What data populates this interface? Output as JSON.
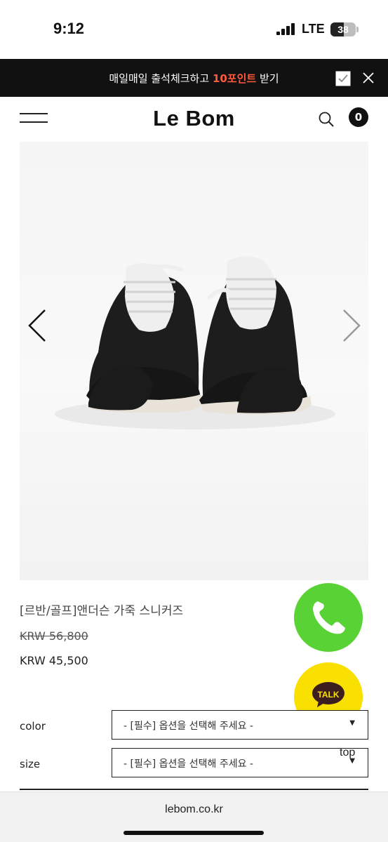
{
  "status_bar": {
    "time": "9:12",
    "network": "LTE",
    "battery": "38"
  },
  "promo": {
    "text_before": "매일매일 출석체크하고 ",
    "highlight": "10포인트",
    "text_after": " 받기",
    "highlight_color": "#ff5a3c"
  },
  "header": {
    "logo": "Le Bom",
    "cart_count": "0"
  },
  "product": {
    "name": "[르반/골프]앤더슨 가죽 스니커즈",
    "price_original": "KRW 56,800",
    "price_sale": "KRW 45,500"
  },
  "options": [
    {
      "label": "color",
      "placeholder": "- [필수] 옵션을 선택해 주세요 -"
    },
    {
      "label": "size",
      "placeholder": "- [필수] 옵션을 선택해 주세요 -"
    }
  ],
  "floating": {
    "talk_label": "TALK",
    "top_label": "top",
    "call_color": "#59d236",
    "talk_color": "#f9e000"
  },
  "browser": {
    "url": "lebom.co.kr"
  },
  "icons": [
    "signal-icon",
    "battery-icon",
    "checkbox-icon",
    "close-icon",
    "menu-icon",
    "search-icon",
    "chevron-left-icon",
    "chevron-right-icon",
    "phone-icon",
    "kakao-talk-icon"
  ]
}
